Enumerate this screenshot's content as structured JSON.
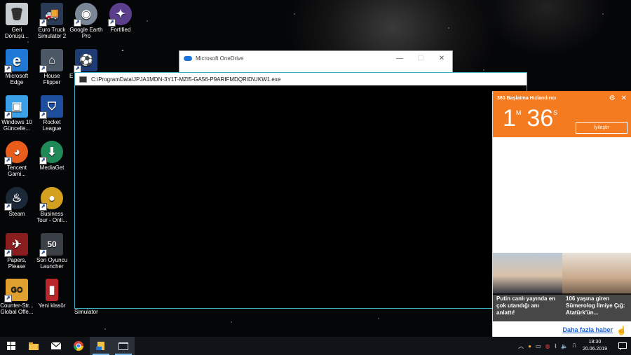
{
  "desktop": {
    "icons": [
      {
        "label": "Geri\nDönüşü...",
        "icon": "recycle-bin-icon",
        "color": "#c7ccd1",
        "glyph": "🗑"
      },
      {
        "label": "Euro Truck\nSimulator 2",
        "icon": "euro-truck-icon",
        "color": "#2b3b56",
        "glyph": "🚚"
      },
      {
        "label": "Google Earth\nPro",
        "icon": "google-earth-icon",
        "color": "#7a8796",
        "glyph": "◉"
      },
      {
        "label": "Fortified",
        "icon": "fortified-icon",
        "color": "#5c3f8c",
        "glyph": "✦"
      },
      {
        "label": "Microsoft\nEdge",
        "icon": "edge-icon",
        "color": "#1e78d4",
        "glyph": "e"
      },
      {
        "label": "House\nFlipper",
        "icon": "house-flipper-icon",
        "color": "#4d5866",
        "glyph": "⌂"
      },
      {
        "label": "E",
        "icon": "pes-icon",
        "color": "#1f3b73",
        "glyph": "⚽"
      },
      {
        "label": "Windows 10\nGüncelle...",
        "icon": "windows-update-icon",
        "color": "#3aa0e8",
        "glyph": "▣"
      },
      {
        "label": "Rocket\nLeague",
        "icon": "rocket-league-icon",
        "color": "#1d4f9e",
        "glyph": "⛉"
      },
      {
        "label": "Tencent\nGami...",
        "icon": "tencent-gaming-icon",
        "color": "#e85d1c",
        "glyph": "◕"
      },
      {
        "label": "MediaGet",
        "icon": "mediaget-icon",
        "color": "#1f8a58",
        "glyph": "⬇"
      },
      {
        "label": "Steam",
        "icon": "steam-icon",
        "color": "#1b2838",
        "glyph": "♨"
      },
      {
        "label": "Business\nTour - Onli...",
        "icon": "business-tour-icon",
        "color": "#d4a020",
        "glyph": "●"
      },
      {
        "label": "Papers,\nPlease",
        "icon": "papers-please-icon",
        "color": "#8a1e1e",
        "glyph": "✈"
      },
      {
        "label": "Son Oyuncu\nLauncher",
        "icon": "son-oyuncu-icon",
        "color": "#3b3f46",
        "glyph": "50"
      },
      {
        "label": "Counter-Str...\nGlobal Offe...",
        "icon": "csgo-icon",
        "color": "#e0a030",
        "glyph": "GO"
      },
      {
        "label": "Yeni klasör",
        "icon": "folder-icon",
        "color": "#b8262b",
        "glyph": "▮"
      }
    ]
  },
  "onedrive_window": {
    "title": "Microsoft OneDrive"
  },
  "console_window": {
    "title": "C:\\ProgramData\\JPJA1MDN-3Y1T-MZI5-GA56-P9ARIFMDQRID\\UKW1.exe"
  },
  "simulator_label": "Simulator",
  "speed_panel": {
    "title": "360 Başlatma Hızlandırıcı",
    "minutes": "1",
    "minutes_unit": "M",
    "seconds": "36",
    "seconds_unit": "S",
    "optimize_label": "İyileştir",
    "news": [
      {
        "caption": "Putin canlı yayında en çok utandığı anı anlattı!"
      },
      {
        "caption": "106 yaşına giren Sümerolog İlmiye Çığ: Atatürk'ün..."
      }
    ],
    "more_label": "Daha fazla haber"
  },
  "taskbar": {
    "clock_time": "18:30",
    "clock_date": "20.06.2019"
  }
}
